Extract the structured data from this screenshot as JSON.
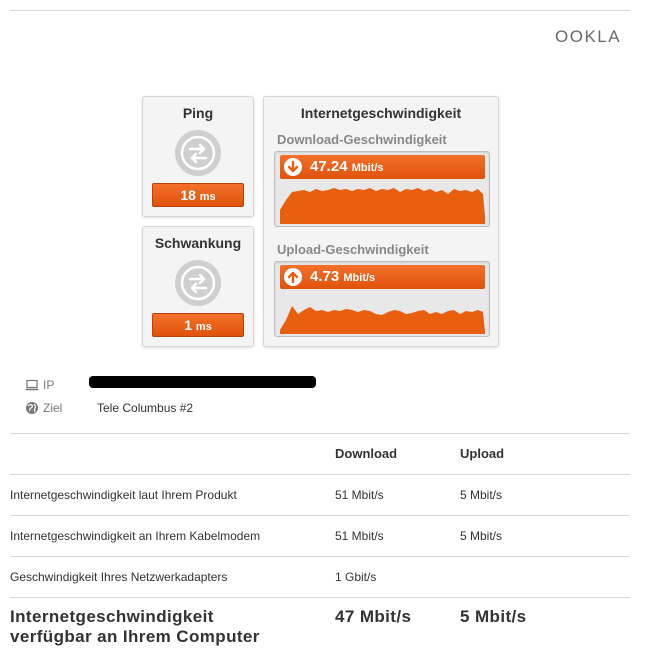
{
  "brand": {
    "logo_text": "OOKLA"
  },
  "ping": {
    "title": "Ping",
    "value": "18",
    "unit": "ms"
  },
  "jitter": {
    "title": "Schwankung",
    "value": "1",
    "unit": "ms"
  },
  "speed": {
    "title": "Internetgeschwindigkeit",
    "download": {
      "label": "Download-Geschwindigkeit",
      "value": "47.24",
      "unit": "Mbit/s"
    },
    "upload": {
      "label": "Upload-Geschwindigkeit",
      "value": "4.73",
      "unit": "Mbit/s"
    }
  },
  "info": {
    "ip_label": "IP",
    "ip_value": "",
    "target_label": "Ziel",
    "target_value": "Tele Columbus #2"
  },
  "table": {
    "headers": [
      "",
      "Download",
      "Upload"
    ],
    "rows": [
      [
        "Internetgeschwindigkeit laut Ihrem Produkt",
        "51 Mbit/s",
        "5 Mbit/s"
      ],
      [
        "Internetgeschwindigkeit an Ihrem Kabelmodem",
        "51 Mbit/s",
        "5 Mbit/s"
      ],
      [
        "Geschwindigkeit Ihres Netzwerkadapters",
        "1 Gbit/s",
        ""
      ]
    ],
    "summary": {
      "label_line1": "Internetgeschwindigkeit",
      "label_line2": "verfügbar an Ihrem Computer",
      "download": "47 Mbit/s",
      "upload": "5 Mbit/s"
    }
  },
  "colors": {
    "accent": "#e8600f",
    "card_bg": "#f4f4f4",
    "icon_gray": "#cfcfcf"
  },
  "icons": [
    "laptop-icon",
    "globe-icon",
    "swap-arrows-icon",
    "download-arrow-icon",
    "upload-arrow-icon"
  ]
}
